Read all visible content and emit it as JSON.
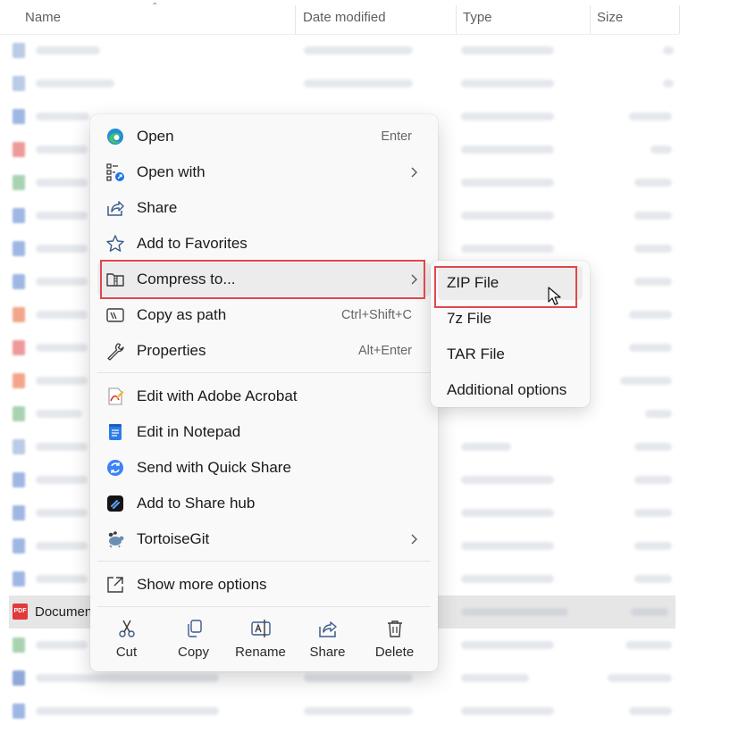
{
  "columns": {
    "name": "Name",
    "date_modified": "Date modified",
    "type": "Type",
    "size": "Size"
  },
  "selected_file": {
    "name": "Documen",
    "icon": "pdf-file-icon",
    "badge": "PDF"
  },
  "context_menu": {
    "items": [
      {
        "label": "Open",
        "shortcut": "Enter",
        "icon": "edge-icon"
      },
      {
        "label": "Open with",
        "icon": "open-with-icon"
      },
      {
        "label": "Share",
        "icon": "share-icon"
      },
      {
        "label": "Add to Favorites",
        "icon": "star-icon"
      },
      {
        "label": "Compress to...",
        "icon": "zip-folder-icon"
      },
      {
        "label": "Copy as path",
        "shortcut": "Ctrl+Shift+C",
        "icon": "path-icon"
      },
      {
        "label": "Properties",
        "shortcut": "Alt+Enter",
        "icon": "wrench-icon"
      },
      {
        "label": "Edit with Adobe Acrobat",
        "icon": "acrobat-icon"
      },
      {
        "label": "Edit in Notepad",
        "icon": "notepad-icon"
      },
      {
        "label": "Send with Quick Share",
        "icon": "quick-share-icon"
      },
      {
        "label": "Add to Share hub",
        "icon": "share-hub-icon"
      },
      {
        "label": "TortoiseGit",
        "icon": "tortoisegit-icon"
      },
      {
        "label": "Show more options",
        "icon": "show-more-icon"
      }
    ],
    "bottom_bar": [
      {
        "label": "Cut",
        "icon": "scissors-icon"
      },
      {
        "label": "Copy",
        "icon": "copy-icon"
      },
      {
        "label": "Rename",
        "icon": "rename-icon"
      },
      {
        "label": "Share",
        "icon": "share-icon"
      },
      {
        "label": "Delete",
        "icon": "trash-icon"
      }
    ]
  },
  "compress_submenu": {
    "items": [
      {
        "label": "ZIP File"
      },
      {
        "label": "7z File"
      },
      {
        "label": "TAR File"
      },
      {
        "label": "Additional options"
      }
    ]
  },
  "colors": {
    "highlight_border": "#e0474c",
    "menu_background": "#f9f9f9",
    "hover_background": "#ececec",
    "selected_row": "#e6e6e6"
  }
}
